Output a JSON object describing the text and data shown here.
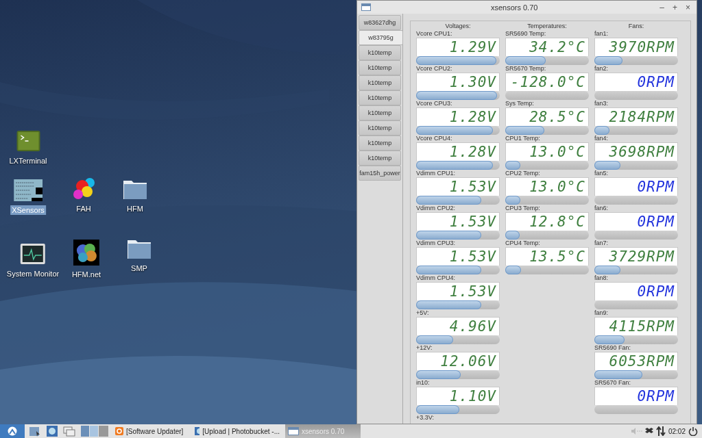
{
  "desktop": {
    "icons": [
      {
        "label": "LXTerminal",
        "kind": "terminal",
        "selected": false
      },
      {
        "label": "XSensors",
        "kind": "sensors",
        "selected": true
      },
      {
        "label": "FAH",
        "kind": "fah",
        "selected": false
      },
      {
        "label": "HFM",
        "kind": "folder",
        "selected": false
      },
      {
        "label": "System Monitor",
        "kind": "monitor",
        "selected": false
      },
      {
        "label": "HFM.net",
        "kind": "protein",
        "selected": false
      },
      {
        "label": "SMP",
        "kind": "folder",
        "selected": false
      }
    ]
  },
  "window": {
    "title": "xsensors 0.70",
    "controls": [
      "–",
      "+",
      "×"
    ],
    "tabs": [
      {
        "label": "w83627dhg",
        "selected": false
      },
      {
        "label": "w83795g",
        "selected": true
      },
      {
        "label": "k10temp",
        "selected": false
      },
      {
        "label": "k10temp",
        "selected": false
      },
      {
        "label": "k10temp",
        "selected": false
      },
      {
        "label": "k10temp",
        "selected": false
      },
      {
        "label": "k10temp",
        "selected": false
      },
      {
        "label": "k10temp",
        "selected": false
      },
      {
        "label": "k10temp",
        "selected": false
      },
      {
        "label": "k10temp",
        "selected": false
      },
      {
        "label": "fam15h_power",
        "selected": false
      }
    ],
    "columns": [
      {
        "heading": "Voltages:",
        "sensors": [
          {
            "label": "Vcore CPU1:",
            "value": "1.29V",
            "low": false,
            "level": 0.96
          },
          {
            "label": "Vcore CPU2:",
            "value": "1.30V",
            "low": false,
            "level": 0.97
          },
          {
            "label": "Vcore CPU3:",
            "value": "1.28V",
            "low": false,
            "level": 0.92
          },
          {
            "label": "Vcore CPU4:",
            "value": "1.28V",
            "low": false,
            "level": 0.92
          },
          {
            "label": "Vdimm CPU1:",
            "value": "1.53V",
            "low": false,
            "level": 0.78
          },
          {
            "label": "Vdimm CPU2:",
            "value": "1.53V",
            "low": false,
            "level": 0.78
          },
          {
            "label": "Vdimm CPU3:",
            "value": "1.53V",
            "low": false,
            "level": 0.78
          },
          {
            "label": "Vdimm CPU4:",
            "value": "1.53V",
            "low": false,
            "level": 0.78
          },
          {
            "label": "+5V:",
            "value": "4.96V",
            "low": false,
            "level": 0.44
          },
          {
            "label": "+12V:",
            "value": "12.06V",
            "low": false,
            "level": 0.53
          },
          {
            "label": "in10:",
            "value": "1.10V",
            "low": false,
            "level": 0.52
          },
          {
            "label": "+3.3V:"
          }
        ]
      },
      {
        "heading": "Temperatures:",
        "sensors": [
          {
            "label": "SR5690 Temp:",
            "value": "34.2°C",
            "low": false,
            "level": 0.48
          },
          {
            "label": "SR5670 Temp:",
            "value": "-128.0°C",
            "low": false
          },
          {
            "label": "Sys Temp:",
            "value": "28.5°C",
            "low": false,
            "level": 0.47
          },
          {
            "label": "CPU1 Temp:",
            "value": "13.0°C",
            "low": false,
            "level": 0.18
          },
          {
            "label": "CPU2 Temp:",
            "value": "13.0°C",
            "low": false,
            "level": 0.18
          },
          {
            "label": "CPU3 Temp:",
            "value": "12.8°C",
            "low": false,
            "level": 0.17
          },
          {
            "label": "CPU4 Temp:",
            "value": "13.5°C",
            "low": false,
            "level": 0.19
          }
        ]
      },
      {
        "heading": "Fans:",
        "sensors": [
          {
            "label": "fan1:",
            "value": "3970RPM",
            "low": false,
            "level": 0.34
          },
          {
            "label": "fan2:",
            "value": "0RPM",
            "low": true
          },
          {
            "label": "fan3:",
            "value": "2184RPM",
            "low": false,
            "level": 0.18
          },
          {
            "label": "fan4:",
            "value": "3698RPM",
            "low": false,
            "level": 0.31
          },
          {
            "label": "fan5:",
            "value": "0RPM",
            "low": true
          },
          {
            "label": "fan6:",
            "value": "0RPM",
            "low": true
          },
          {
            "label": "fan7:",
            "value": "3729RPM",
            "low": false,
            "level": 0.31
          },
          {
            "label": "fan8:",
            "value": "0RPM",
            "low": true
          },
          {
            "label": "fan9:",
            "value": "4115RPM",
            "low": false,
            "level": 0.36
          },
          {
            "label": "SR5690 Fan:",
            "value": "6053RPM",
            "low": false,
            "level": 0.57
          },
          {
            "label": "SR5670 Fan:",
            "value": "0RPM",
            "low": true
          }
        ]
      }
    ]
  },
  "taskbar": {
    "tasks": [
      {
        "label": "[Software Updater]",
        "kind": "updater",
        "selected": false
      },
      {
        "label": "[Upload | Photobucket -...",
        "kind": "browser",
        "selected": false
      },
      {
        "label": "xsensors 0.70",
        "kind": "window",
        "selected": true
      }
    ],
    "clock": "02:02"
  }
}
